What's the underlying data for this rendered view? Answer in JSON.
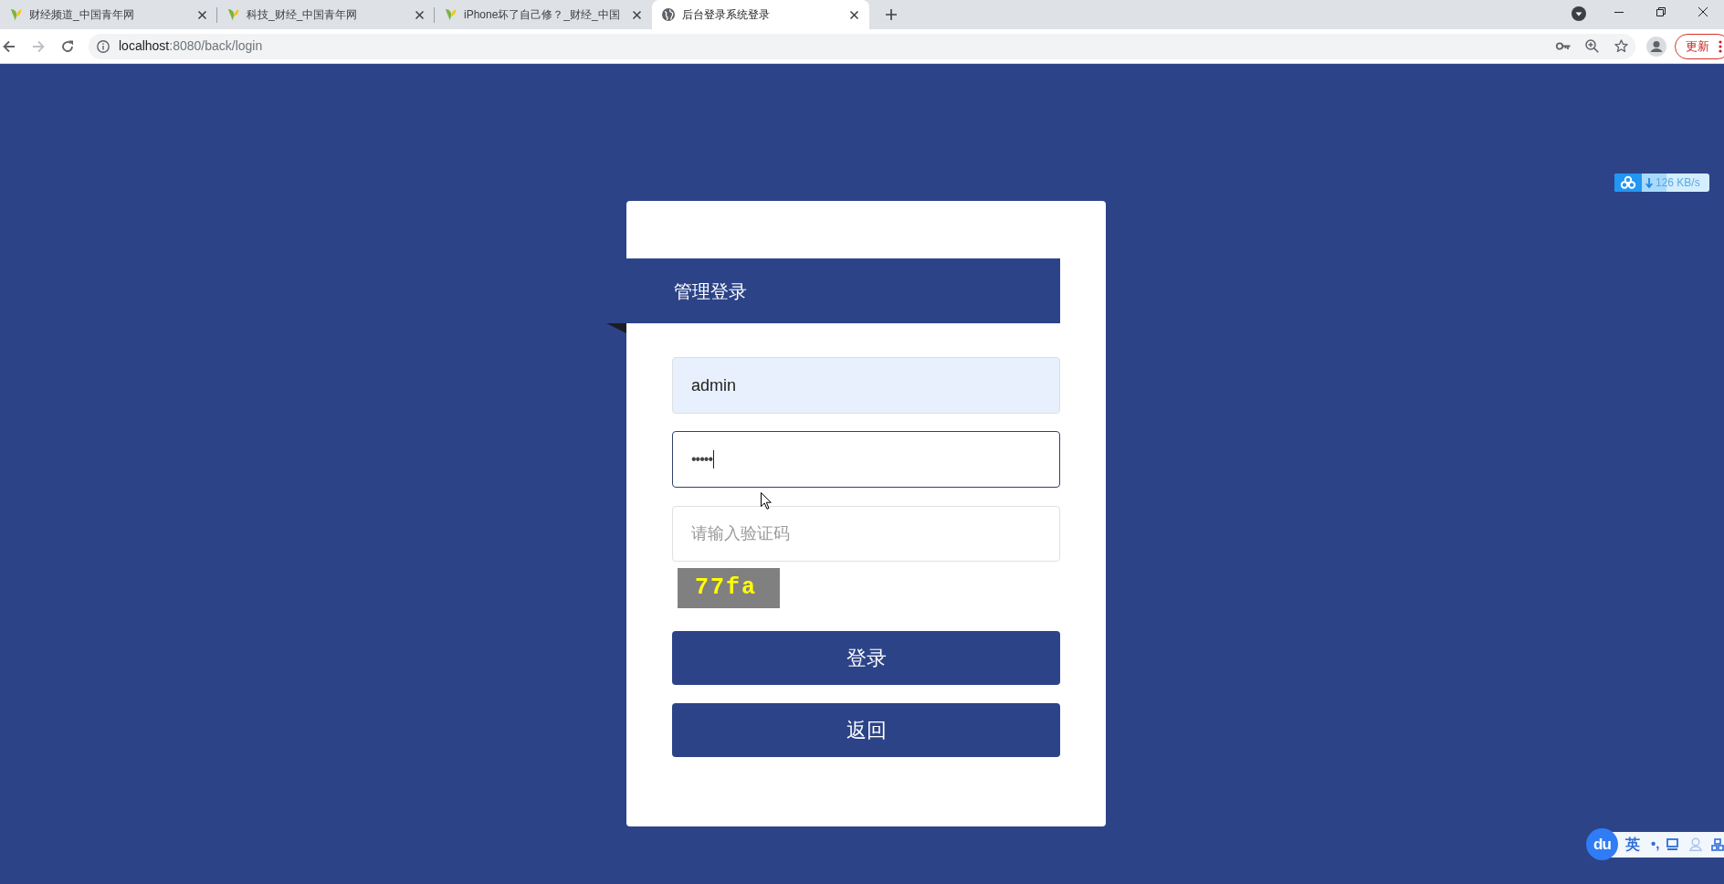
{
  "tabs": [
    {
      "title": "财经频道_中国青年网",
      "kind": "site",
      "selected": false
    },
    {
      "title": "科技_财经_中国青年网",
      "kind": "site",
      "selected": false
    },
    {
      "title": "iPhone坏了自己修？_财经_中国",
      "kind": "site",
      "selected": false
    },
    {
      "title": "后台登录系统登录",
      "kind": "generic",
      "selected": true
    }
  ],
  "address_bar": {
    "host": "localhost",
    "path": ":8080/back/login"
  },
  "update_button": "更新",
  "login": {
    "title": "管理登录",
    "username": {
      "value": "admin",
      "autofilled": true
    },
    "password": {
      "value": "•••••",
      "focused": true
    },
    "captcha": {
      "placeholder": "请输入验证码"
    },
    "captcha_image": "77fa",
    "buttons": [
      "登录",
      "返回"
    ]
  },
  "download_widget": {
    "speed": "126 KB/s"
  },
  "ime_bar": {
    "logo": "du",
    "mode": "英",
    "punctuation": "•,"
  }
}
